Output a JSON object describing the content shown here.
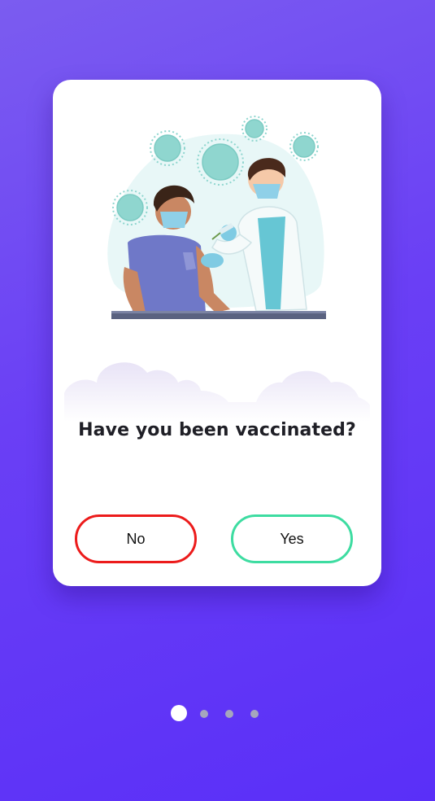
{
  "card": {
    "question": "Have you been vaccinated?",
    "no_label": "No",
    "yes_label": "Yes"
  },
  "colors": {
    "no_border": "#ec1b1b",
    "yes_border": "#3ddca1",
    "background_top": "#7b5cf0",
    "background_bottom": "#5a2ff8"
  },
  "pagination": {
    "total": 4,
    "active_index": 0
  },
  "icons": {
    "illustration": "vaccination-illustration",
    "virus": "virus-icon"
  }
}
